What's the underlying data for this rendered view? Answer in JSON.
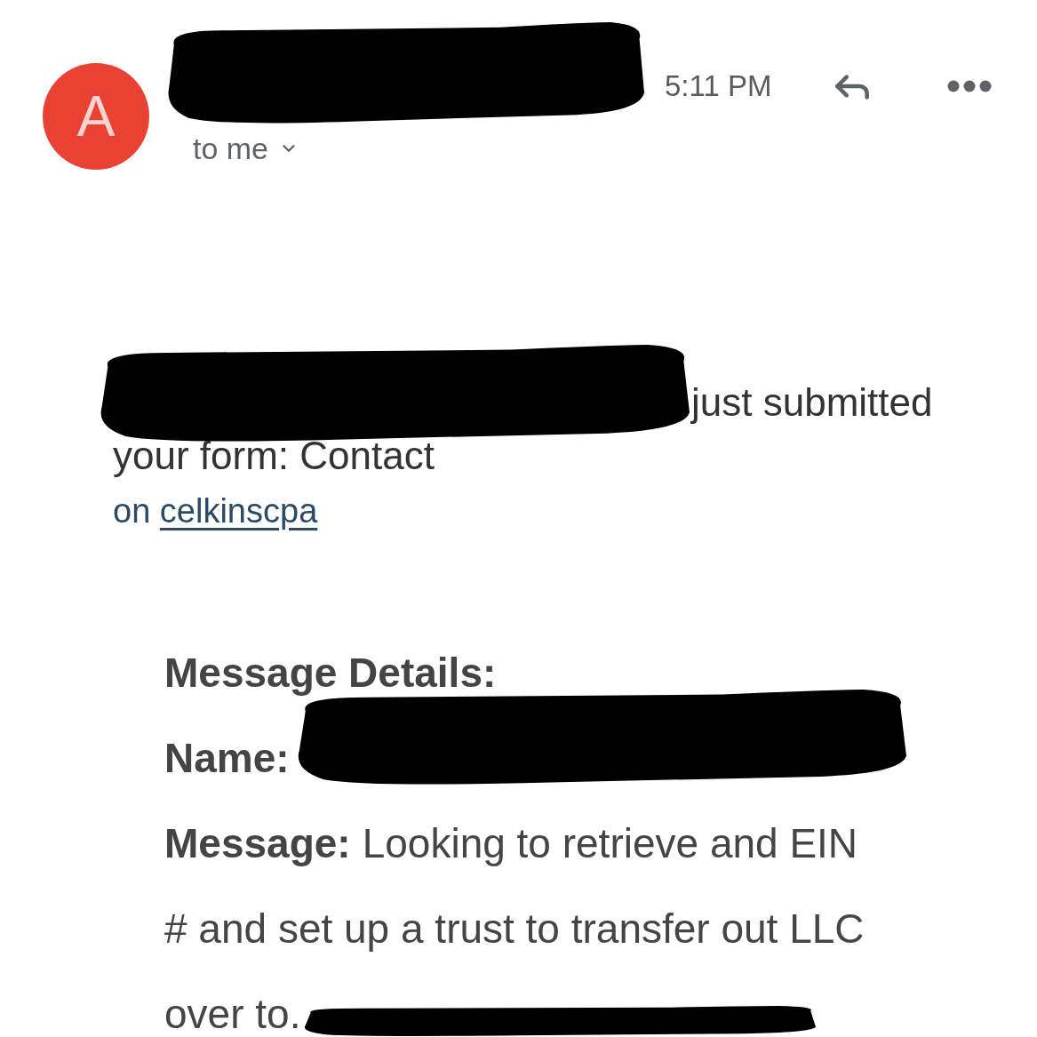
{
  "header": {
    "avatar_letter": "A",
    "time": "5:11 PM",
    "recipients": "to me"
  },
  "body": {
    "intro_lines": [
      "just submitted",
      "your form: Contact"
    ],
    "source": {
      "prefix": "on",
      "link": "celkinscpa"
    }
  },
  "details": {
    "heading": "Message Details:",
    "name_label": "Name:",
    "message_label": "Message:",
    "message_lines": [
      "Looking to retrieve and EIN",
      "# and set up a trust to transfer out LLC",
      "over to."
    ]
  }
}
